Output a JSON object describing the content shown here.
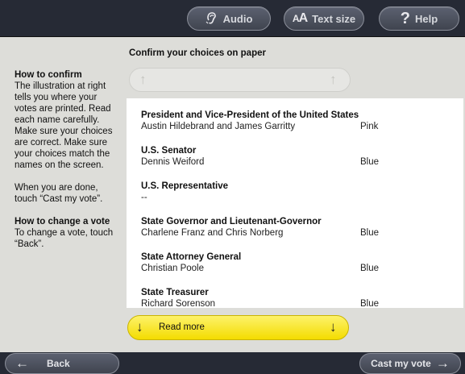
{
  "toolbar": {
    "audio_label": "Audio",
    "text_size_prefix": "A",
    "text_size_big": "A",
    "text_size_label": "Text size",
    "help_label": "Help",
    "help_icon": "?",
    "audio_icon": "ear-icon"
  },
  "sidebar": {
    "confirm_heading": "How to confirm",
    "confirm_text": "The illustration at right tells you where your votes are printed. Read each name carefully. Make sure your choices are correct. Make sure your choices match the names on the screen.",
    "done_text": "When you are done, touch “Cast my vote”.",
    "change_heading": "How to change a vote",
    "change_text": "To change a vote, touch “Back”."
  },
  "main": {
    "title": "Confirm your choices on paper",
    "up_arrow": "↑",
    "contests": [
      {
        "title": "President and Vice-President of the United States",
        "choice": "Austin Hildebrand and James Garritty",
        "party": "Pink"
      },
      {
        "title": "U.S. Senator",
        "choice": "Dennis Weiford",
        "party": "Blue"
      },
      {
        "title": "U.S. Representative",
        "choice": "--",
        "party": ""
      },
      {
        "title": "State Governor and Lieutenant-Governor",
        "choice": "Charlene Franz and Chris Norberg",
        "party": "Blue"
      },
      {
        "title": "State Attorney General",
        "choice": "Christian Poole",
        "party": "Blue"
      },
      {
        "title": "State Treasurer",
        "choice": "Richard Sorenson",
        "party": "Blue"
      }
    ],
    "read_more_label": "Read more",
    "down_arrow": "↓"
  },
  "footer": {
    "back_label": "Back",
    "back_icon": "←",
    "cast_label": "Cast my vote",
    "cast_icon": "→"
  },
  "colors": {
    "topbar": "#262a35",
    "read_more": "#f8e52e",
    "background": "#ddddd9"
  }
}
